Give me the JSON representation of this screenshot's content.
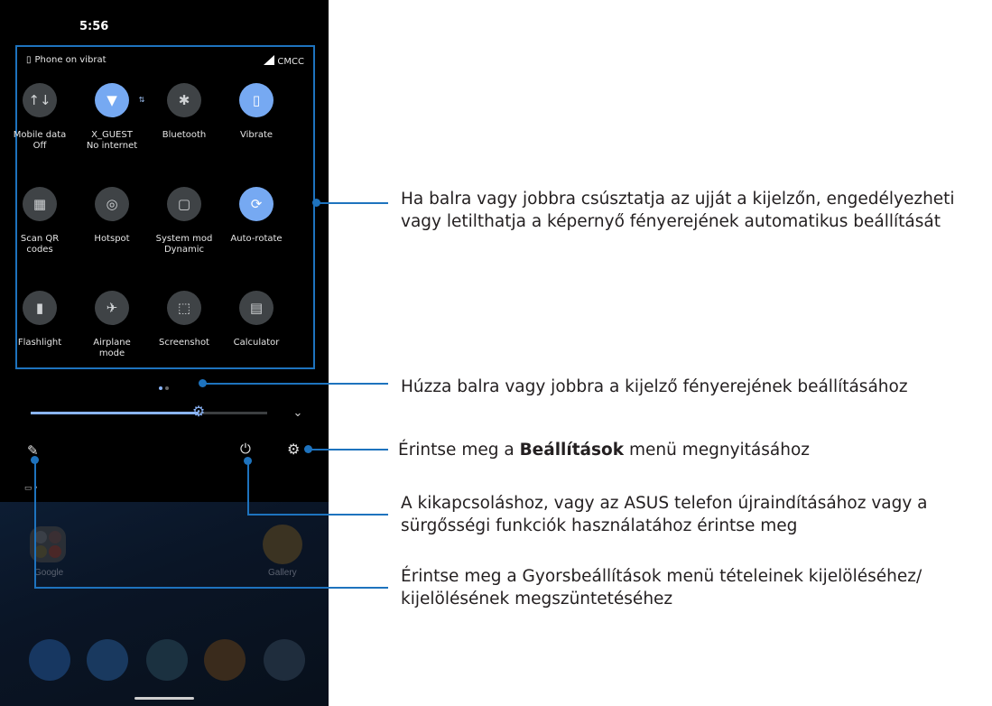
{
  "status_bar": {
    "time": "5:56"
  },
  "notification_row": {
    "vibrate_text": "Phone on vibrat",
    "carrier": "CMCC"
  },
  "tiles": [
    {
      "label": "Mobile data",
      "sub": "Off",
      "icon": "mobile-data-icon",
      "glyph": "↑↓",
      "on": false
    },
    {
      "label": "X_GUEST",
      "sub": "No internet",
      "icon": "wifi-icon",
      "glyph": "▼",
      "on": true
    },
    {
      "label": "Bluetooth",
      "sub": "",
      "icon": "bluetooth-icon",
      "glyph": "✱",
      "on": false
    },
    {
      "label": "Vibrate",
      "sub": "",
      "icon": "vibrate-icon",
      "glyph": "▯",
      "on": true
    },
    {
      "label": "Scan QR",
      "sub": "codes",
      "icon": "qr-code-icon",
      "glyph": "▦",
      "on": false
    },
    {
      "label": "Hotspot",
      "sub": "",
      "icon": "hotspot-icon",
      "glyph": "◎",
      "on": false
    },
    {
      "label": "System mod",
      "sub": "Dynamic",
      "icon": "system-mode-icon",
      "glyph": "▢",
      "on": false
    },
    {
      "label": "Auto-rotate",
      "sub": "",
      "icon": "auto-rotate-icon",
      "glyph": "⟳",
      "on": true
    },
    {
      "label": "Flashlight",
      "sub": "",
      "icon": "flashlight-icon",
      "glyph": "▮",
      "on": false
    },
    {
      "label": "Airplane",
      "sub": "mode",
      "icon": "airplane-icon",
      "glyph": "✈",
      "on": false
    },
    {
      "label": "Screenshot",
      "sub": "",
      "icon": "screenshot-icon",
      "glyph": "⬚",
      "on": false
    },
    {
      "label": "Calculator",
      "sub": "",
      "icon": "calculator-icon",
      "glyph": "▤",
      "on": false
    }
  ],
  "brightness": {
    "level": 0.71
  },
  "home": {
    "google_label": "Google",
    "gallery_label": "Gallery"
  },
  "callouts": {
    "swipe_line1": "Ha balra vagy jobbra csúsztatja az ujját a kijelzőn, engedélyezheti",
    "swipe_line2": "vagy letilthatja a képernyő fényerejének automatikus beállítását",
    "brightness": "Húzza balra vagy jobbra a kijelző fényerejének beállításához",
    "settings_before": "Érintse meg a ",
    "settings_bold": "Beállítások",
    "settings_after": " menü megnyitásához",
    "power_line1": "A kikapcsoláshoz, vagy az ASUS telefon újraindításához vagy a",
    "power_line2": "sürgősségi funkciók használatához érintse meg",
    "edit_line1": "Érintse meg a Gyorsbeállítások menü tételeinek kijelöléséhez/",
    "edit_line2": "kijelölésének megszüntetéséhez"
  },
  "colors": {
    "accent": "#1e73be",
    "tile_on": "#76a9f2",
    "tile_off": "#3f4346"
  }
}
